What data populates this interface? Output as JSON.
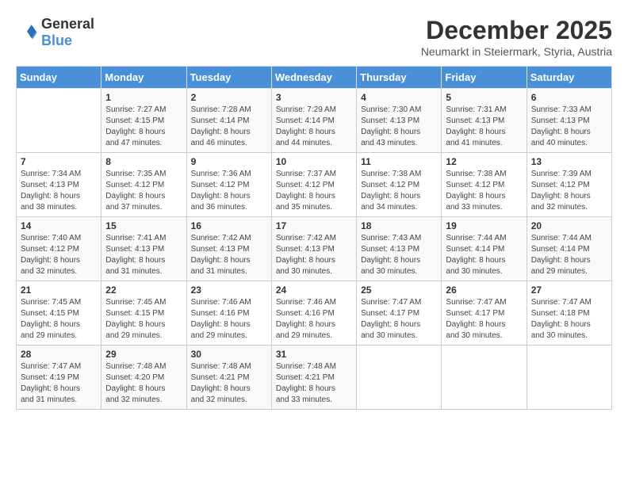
{
  "header": {
    "logo_general": "General",
    "logo_blue": "Blue",
    "month_year": "December 2025",
    "location": "Neumarkt in Steiermark, Styria, Austria"
  },
  "days_of_week": [
    "Sunday",
    "Monday",
    "Tuesday",
    "Wednesday",
    "Thursday",
    "Friday",
    "Saturday"
  ],
  "weeks": [
    [
      {
        "day": "",
        "info": ""
      },
      {
        "day": "1",
        "info": "Sunrise: 7:27 AM\nSunset: 4:15 PM\nDaylight: 8 hours\nand 47 minutes."
      },
      {
        "day": "2",
        "info": "Sunrise: 7:28 AM\nSunset: 4:14 PM\nDaylight: 8 hours\nand 46 minutes."
      },
      {
        "day": "3",
        "info": "Sunrise: 7:29 AM\nSunset: 4:14 PM\nDaylight: 8 hours\nand 44 minutes."
      },
      {
        "day": "4",
        "info": "Sunrise: 7:30 AM\nSunset: 4:13 PM\nDaylight: 8 hours\nand 43 minutes."
      },
      {
        "day": "5",
        "info": "Sunrise: 7:31 AM\nSunset: 4:13 PM\nDaylight: 8 hours\nand 41 minutes."
      },
      {
        "day": "6",
        "info": "Sunrise: 7:33 AM\nSunset: 4:13 PM\nDaylight: 8 hours\nand 40 minutes."
      }
    ],
    [
      {
        "day": "7",
        "info": "Sunrise: 7:34 AM\nSunset: 4:13 PM\nDaylight: 8 hours\nand 38 minutes."
      },
      {
        "day": "8",
        "info": "Sunrise: 7:35 AM\nSunset: 4:12 PM\nDaylight: 8 hours\nand 37 minutes."
      },
      {
        "day": "9",
        "info": "Sunrise: 7:36 AM\nSunset: 4:12 PM\nDaylight: 8 hours\nand 36 minutes."
      },
      {
        "day": "10",
        "info": "Sunrise: 7:37 AM\nSunset: 4:12 PM\nDaylight: 8 hours\nand 35 minutes."
      },
      {
        "day": "11",
        "info": "Sunrise: 7:38 AM\nSunset: 4:12 PM\nDaylight: 8 hours\nand 34 minutes."
      },
      {
        "day": "12",
        "info": "Sunrise: 7:38 AM\nSunset: 4:12 PM\nDaylight: 8 hours\nand 33 minutes."
      },
      {
        "day": "13",
        "info": "Sunrise: 7:39 AM\nSunset: 4:12 PM\nDaylight: 8 hours\nand 32 minutes."
      }
    ],
    [
      {
        "day": "14",
        "info": "Sunrise: 7:40 AM\nSunset: 4:12 PM\nDaylight: 8 hours\nand 32 minutes."
      },
      {
        "day": "15",
        "info": "Sunrise: 7:41 AM\nSunset: 4:13 PM\nDaylight: 8 hours\nand 31 minutes."
      },
      {
        "day": "16",
        "info": "Sunrise: 7:42 AM\nSunset: 4:13 PM\nDaylight: 8 hours\nand 31 minutes."
      },
      {
        "day": "17",
        "info": "Sunrise: 7:42 AM\nSunset: 4:13 PM\nDaylight: 8 hours\nand 30 minutes."
      },
      {
        "day": "18",
        "info": "Sunrise: 7:43 AM\nSunset: 4:13 PM\nDaylight: 8 hours\nand 30 minutes."
      },
      {
        "day": "19",
        "info": "Sunrise: 7:44 AM\nSunset: 4:14 PM\nDaylight: 8 hours\nand 30 minutes."
      },
      {
        "day": "20",
        "info": "Sunrise: 7:44 AM\nSunset: 4:14 PM\nDaylight: 8 hours\nand 29 minutes."
      }
    ],
    [
      {
        "day": "21",
        "info": "Sunrise: 7:45 AM\nSunset: 4:15 PM\nDaylight: 8 hours\nand 29 minutes."
      },
      {
        "day": "22",
        "info": "Sunrise: 7:45 AM\nSunset: 4:15 PM\nDaylight: 8 hours\nand 29 minutes."
      },
      {
        "day": "23",
        "info": "Sunrise: 7:46 AM\nSunset: 4:16 PM\nDaylight: 8 hours\nand 29 minutes."
      },
      {
        "day": "24",
        "info": "Sunrise: 7:46 AM\nSunset: 4:16 PM\nDaylight: 8 hours\nand 29 minutes."
      },
      {
        "day": "25",
        "info": "Sunrise: 7:47 AM\nSunset: 4:17 PM\nDaylight: 8 hours\nand 30 minutes."
      },
      {
        "day": "26",
        "info": "Sunrise: 7:47 AM\nSunset: 4:17 PM\nDaylight: 8 hours\nand 30 minutes."
      },
      {
        "day": "27",
        "info": "Sunrise: 7:47 AM\nSunset: 4:18 PM\nDaylight: 8 hours\nand 30 minutes."
      }
    ],
    [
      {
        "day": "28",
        "info": "Sunrise: 7:47 AM\nSunset: 4:19 PM\nDaylight: 8 hours\nand 31 minutes."
      },
      {
        "day": "29",
        "info": "Sunrise: 7:48 AM\nSunset: 4:20 PM\nDaylight: 8 hours\nand 32 minutes."
      },
      {
        "day": "30",
        "info": "Sunrise: 7:48 AM\nSunset: 4:21 PM\nDaylight: 8 hours\nand 32 minutes."
      },
      {
        "day": "31",
        "info": "Sunrise: 7:48 AM\nSunset: 4:21 PM\nDaylight: 8 hours\nand 33 minutes."
      },
      {
        "day": "",
        "info": ""
      },
      {
        "day": "",
        "info": ""
      },
      {
        "day": "",
        "info": ""
      }
    ]
  ]
}
